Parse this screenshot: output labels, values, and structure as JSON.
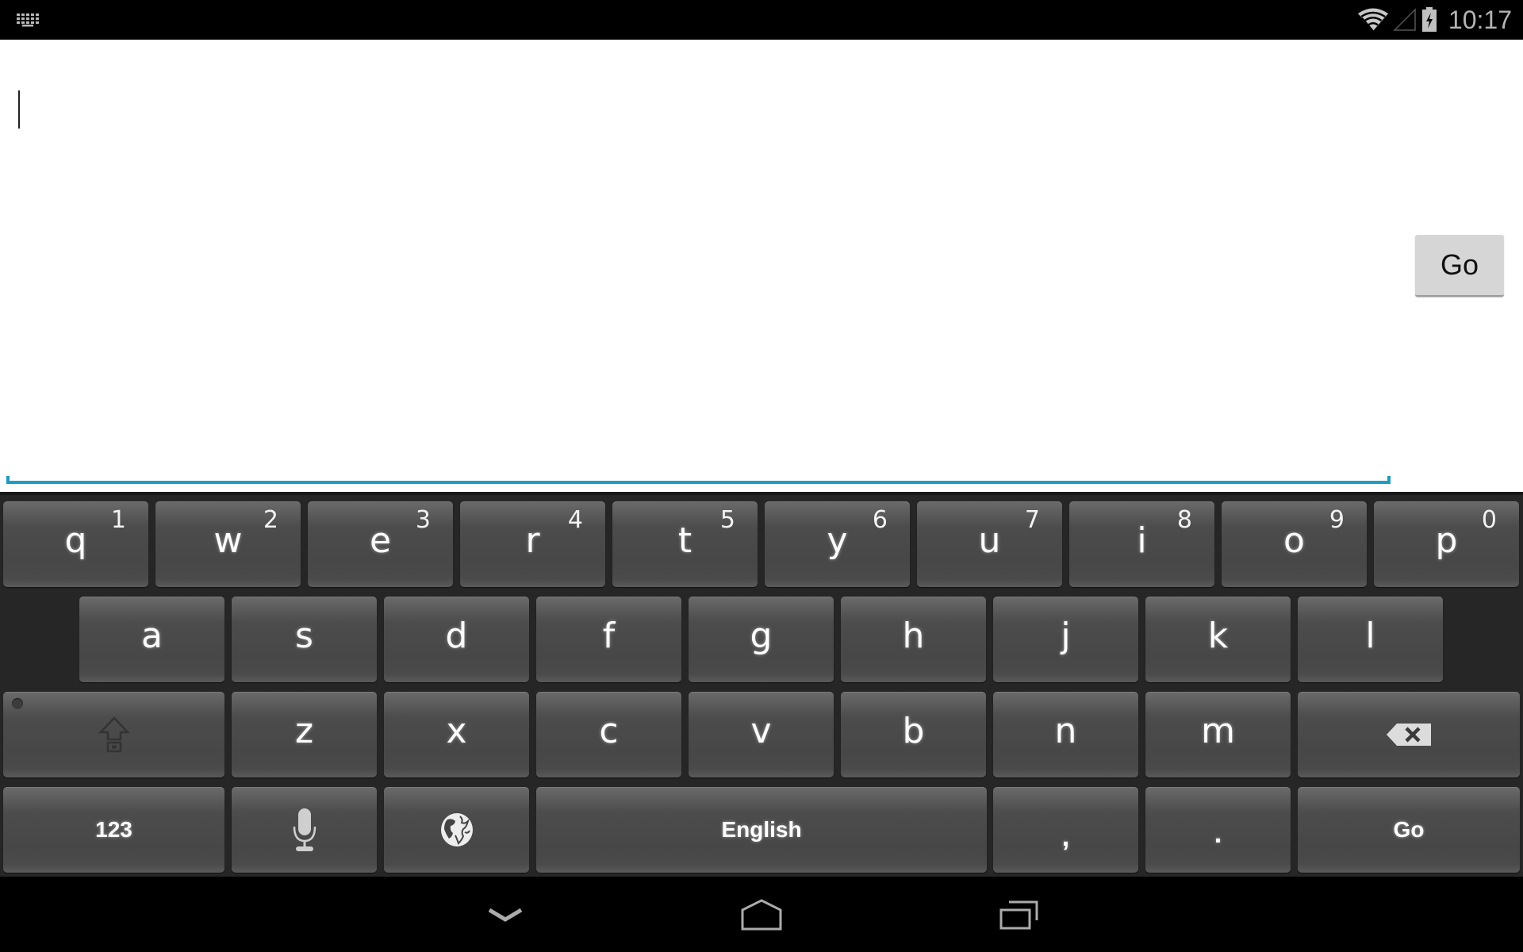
{
  "status_bar": {
    "time": "10:17",
    "icons": [
      "keyboard-icon",
      "wifi-icon",
      "cell-signal-icon",
      "battery-charging-icon"
    ]
  },
  "text_field": {
    "value": "",
    "placeholder": "",
    "accent_color": "#1a9ec4"
  },
  "go_button": {
    "label": "Go"
  },
  "keyboard": {
    "row1": [
      {
        "key": "q",
        "hint": "1"
      },
      {
        "key": "w",
        "hint": "2"
      },
      {
        "key": "e",
        "hint": "3"
      },
      {
        "key": "r",
        "hint": "4"
      },
      {
        "key": "t",
        "hint": "5"
      },
      {
        "key": "y",
        "hint": "6"
      },
      {
        "key": "u",
        "hint": "7"
      },
      {
        "key": "i",
        "hint": "8"
      },
      {
        "key": "o",
        "hint": "9"
      },
      {
        "key": "p",
        "hint": "0"
      }
    ],
    "row2": [
      "a",
      "s",
      "d",
      "f",
      "g",
      "h",
      "j",
      "k",
      "l"
    ],
    "row3": [
      "z",
      "x",
      "c",
      "v",
      "b",
      "n",
      "m"
    ],
    "shift_icon": "shift-lock-icon",
    "delete_icon": "backspace-icon",
    "bottom": {
      "symbols_label": "123",
      "mic_icon": "microphone-icon",
      "language_icon": "globe-icon",
      "space_label": "English",
      "comma": ",",
      "period": ".",
      "action_label": "Go"
    }
  },
  "nav_bar": {
    "buttons": [
      "hide-keyboard",
      "home",
      "recent-apps"
    ]
  }
}
